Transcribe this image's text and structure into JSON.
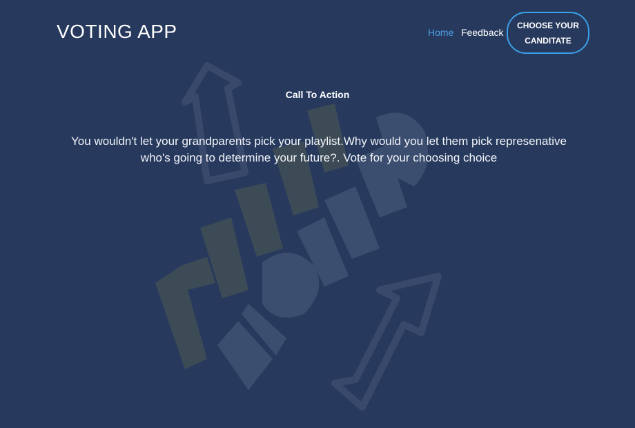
{
  "navbar": {
    "brand": "VOTING APP",
    "links": [
      {
        "label": "Home",
        "active": true
      },
      {
        "label": "Feedback",
        "active": false
      }
    ],
    "cta_label": "CHOOSE YOUR CANDITATE"
  },
  "hero": {
    "title": "Call To Action",
    "text": "You wouldn't let your grandparents pick your playlist.Why would you let them pick represenative who's going to determine your future?. Vote for your choosing choice",
    "background_image": "happy-voting-3d-letters-with-arrows"
  },
  "colors": {
    "background": "#273a5e",
    "accent": "#3aa0e8",
    "active_link": "#4ea0e6"
  }
}
